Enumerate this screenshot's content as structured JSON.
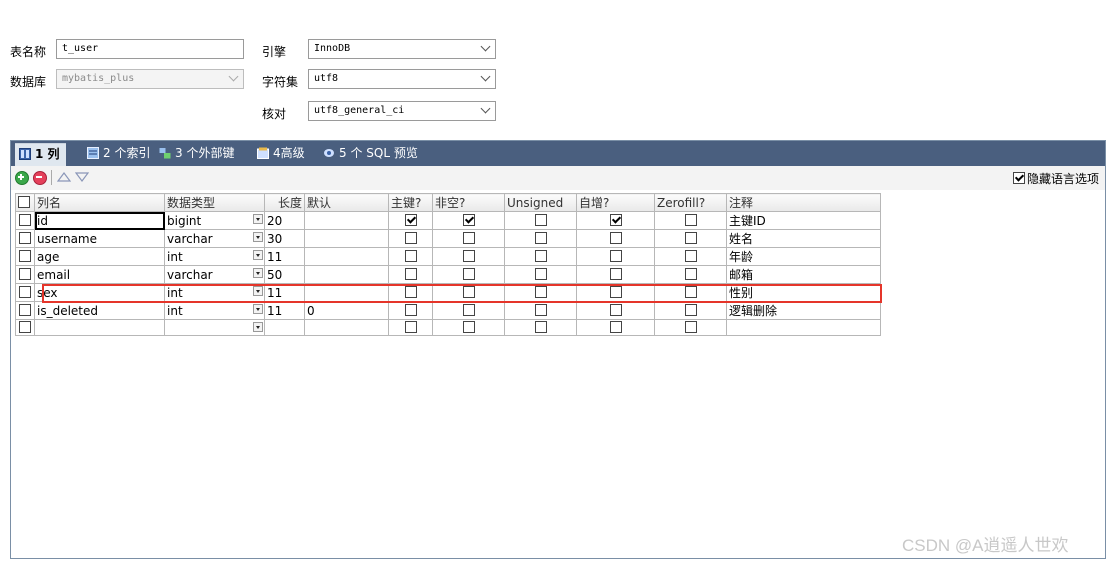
{
  "form": {
    "table_name_label": "表名称",
    "table_name_value": "t_user",
    "database_label": "数据库",
    "database_value": "mybatis_plus",
    "engine_label": "引擎",
    "engine_value": "InnoDB",
    "charset_label": "字符集",
    "charset_value": "utf8",
    "collation_label": "核对",
    "collation_value": "utf8_general_ci"
  },
  "tabs": [
    {
      "label": "1 列",
      "active": true,
      "icon": "columns-icon"
    },
    {
      "label": "2 个索引",
      "active": false,
      "icon": "index-icon"
    },
    {
      "label": "3 个外部键",
      "active": false,
      "icon": "foreign-key-icon"
    },
    {
      "label": "4高级",
      "active": false,
      "icon": "advanced-icon"
    },
    {
      "label": "5 个 SQL 预览",
      "active": false,
      "icon": "sql-preview-icon"
    }
  ],
  "toolbar": {
    "hide_language_label": "隐藏语言选项",
    "hide_language_checked": true
  },
  "columns_header": [
    "列名",
    "数据类型",
    "长度",
    "默认",
    "主键?",
    "非空?",
    "Unsigned",
    "自增?",
    "Zerofill?",
    "注释"
  ],
  "rows": [
    {
      "name": "id",
      "type": "bigint",
      "length": "20",
      "default": "",
      "pk": true,
      "notnull": true,
      "unsigned": false,
      "autoinc": true,
      "zerofill": false,
      "comment": "主键ID"
    },
    {
      "name": "username",
      "type": "varchar",
      "length": "30",
      "default": "",
      "pk": false,
      "notnull": false,
      "unsigned": false,
      "autoinc": false,
      "zerofill": false,
      "comment": "姓名"
    },
    {
      "name": "age",
      "type": "int",
      "length": "11",
      "default": "",
      "pk": false,
      "notnull": false,
      "unsigned": false,
      "autoinc": false,
      "zerofill": false,
      "comment": "年龄"
    },
    {
      "name": "email",
      "type": "varchar",
      "length": "50",
      "default": "",
      "pk": false,
      "notnull": false,
      "unsigned": false,
      "autoinc": false,
      "zerofill": false,
      "comment": "邮箱"
    },
    {
      "name": "sex",
      "type": "int",
      "length": "11",
      "default": "",
      "pk": false,
      "notnull": false,
      "unsigned": false,
      "autoinc": false,
      "zerofill": false,
      "comment": "性别"
    },
    {
      "name": "is_deleted",
      "type": "int",
      "length": "11",
      "default": "0",
      "pk": false,
      "notnull": false,
      "unsigned": false,
      "autoinc": false,
      "zerofill": false,
      "comment": "逻辑删除"
    },
    {
      "name": "",
      "type": "",
      "length": "",
      "default": "",
      "pk": false,
      "notnull": false,
      "unsigned": false,
      "autoinc": false,
      "zerofill": false,
      "comment": ""
    }
  ],
  "watermark": "CSDN @A逍遥人世欢",
  "colors": {
    "tabbar": "#4a5f7f",
    "highlight": "#e5352a"
  }
}
